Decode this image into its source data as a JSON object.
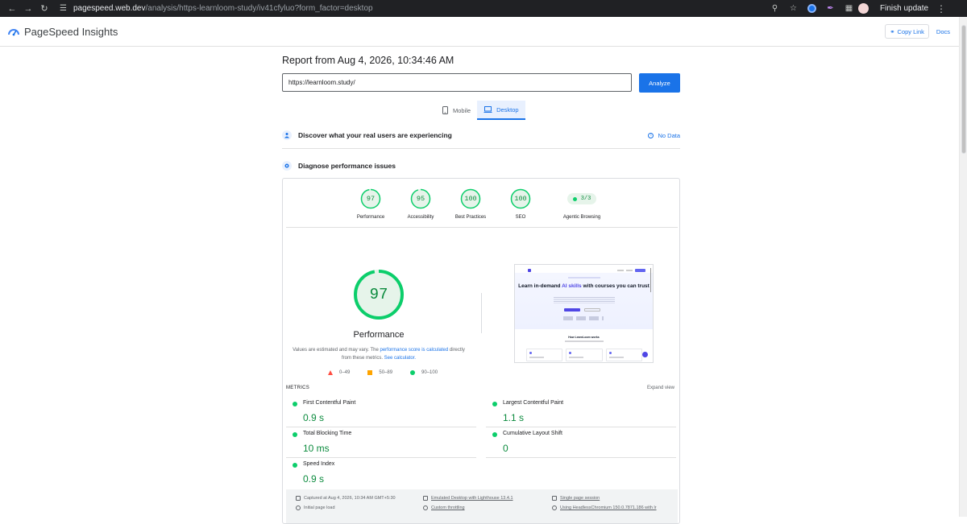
{
  "browser": {
    "url_host": "pagespeed.web.dev",
    "url_path": "/analysis/https-learnloom-study/iv41cfyluo?form_factor=desktop",
    "finish_update": "Finish update"
  },
  "header": {
    "title": "PageSpeed Insights",
    "copy_link": "Copy Link",
    "docs": "Docs"
  },
  "report": {
    "title": "Report from Aug 4, 2026, 10:34:46 AM",
    "url_value": "https://learnloom.study/",
    "analyze": "Analyze",
    "tabs": [
      {
        "label": "Mobile",
        "active": false
      },
      {
        "label": "Desktop",
        "active": true
      }
    ]
  },
  "sections": {
    "real_users": "Discover what your real users are experiencing",
    "no_data": "No Data",
    "diagnose": "Diagnose performance issues"
  },
  "scores": [
    {
      "value": "97",
      "label": "Performance",
      "score": 97
    },
    {
      "value": "95",
      "label": "Accessibility",
      "score": 95
    },
    {
      "value": "100",
      "label": "Best Practices",
      "score": 100
    },
    {
      "value": "100",
      "label": "SEO",
      "score": 100
    }
  ],
  "agentic": {
    "value": "3/3",
    "label": "Agentic Browsing"
  },
  "performance": {
    "score": "97",
    "score_fraction": 0.97,
    "label": "Performance",
    "note_prefix": "Values are estimated and may vary. The ",
    "note_link1": "performance score is calculated",
    "note_middle": " directly from these metrics. ",
    "note_link2": "See calculator.",
    "legend": [
      "0–49",
      "50–89",
      "90–100"
    ]
  },
  "thumbnail": {
    "headline_1": "Learn in-demand ",
    "headline_ai": "AI skills",
    "headline_2": " with courses you can trust",
    "how": "How LearnLoom works"
  },
  "metrics": {
    "header": "METRICS",
    "expand": "Expand view",
    "items": [
      {
        "name": "First Contentful Paint",
        "value": "0.9 s"
      },
      {
        "name": "Largest Contentful Paint",
        "value": "1.1 s"
      },
      {
        "name": "Total Blocking Time",
        "value": "10 ms"
      },
      {
        "name": "Cumulative Layout Shift",
        "value": "0"
      },
      {
        "name": "Speed Index",
        "value": "0.9 s"
      }
    ]
  },
  "footer": {
    "captured": "Captured at Aug 4, 2026, 10:34 AM GMT+5:30",
    "initial_load": "Initial page load",
    "emulated": "Emulated Desktop with Lighthouse 13.4.1",
    "throttling": "Custom throttling",
    "session": "Single page session",
    "browser": "Using HeadlessChromium 150.0.7871.186 with lr"
  },
  "colors": {
    "accent": "#1a73e8",
    "pass": "#0cce6b",
    "pass_text": "#0c8b3e",
    "average": "#ffa400",
    "fail": "#ff4e42"
  }
}
